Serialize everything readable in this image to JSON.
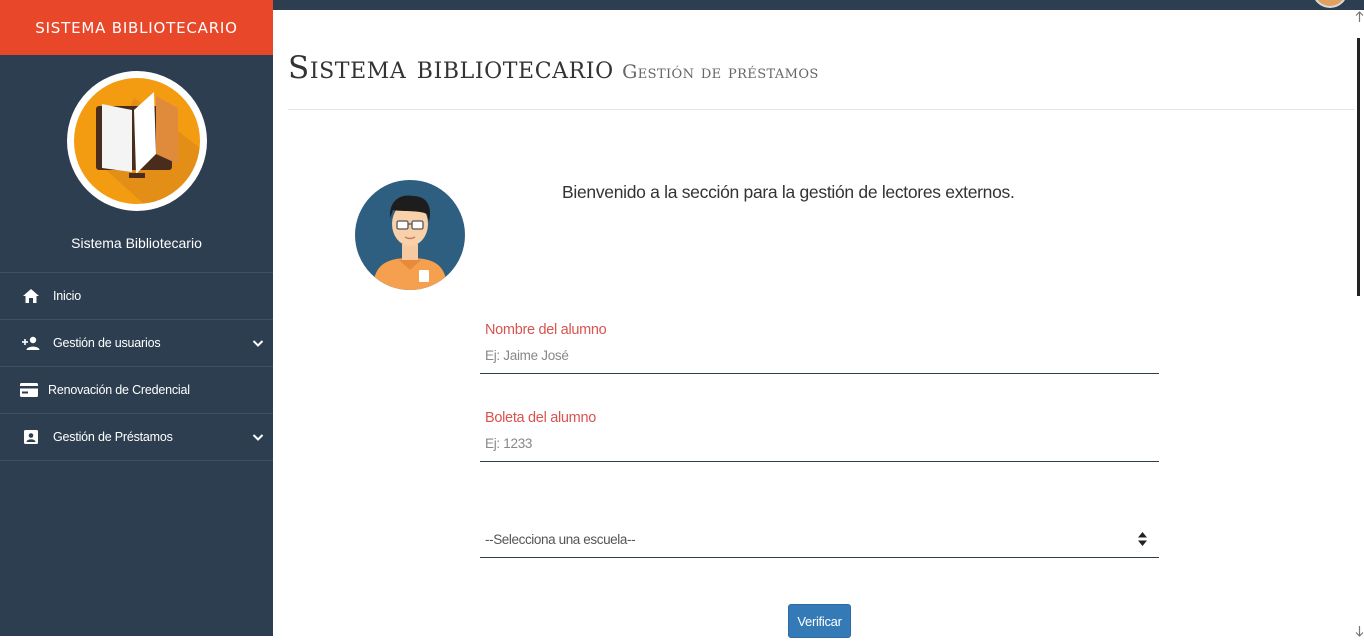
{
  "sidebar": {
    "brand": "SISTEMA BIBLIOTECARIO",
    "profile_name": "Sistema Bibliotecario",
    "items": [
      {
        "label": "Inicio",
        "icon": "home-icon"
      },
      {
        "label": "Gestión de usuarios",
        "icon": "person-add-icon",
        "expandable": true
      },
      {
        "label": "Renovación de Credencial",
        "icon": "credit-card-icon"
      },
      {
        "label": "Gestión de Préstamos",
        "icon": "portrait-icon",
        "expandable": true
      }
    ]
  },
  "header": {
    "title": "Sistema bibliotecario",
    "subtitle": "Gestión de préstamos"
  },
  "main": {
    "welcome": "Bienvenido a la sección para la gestión de lectores externos.",
    "form": {
      "name_label": "Nombre del alumno",
      "name_placeholder": "Ej: Jaime José",
      "boleta_label": "Boleta del alumno",
      "boleta_placeholder": "Ej: 1233",
      "school_select": "--Selecciona una escuela--",
      "verify_label": "Verificar"
    }
  },
  "colors": {
    "brand": "#e8472a",
    "sidebar": "#2c3e50",
    "label": "#d9534f",
    "button": "#337ab7",
    "logo": "#f39c12"
  }
}
